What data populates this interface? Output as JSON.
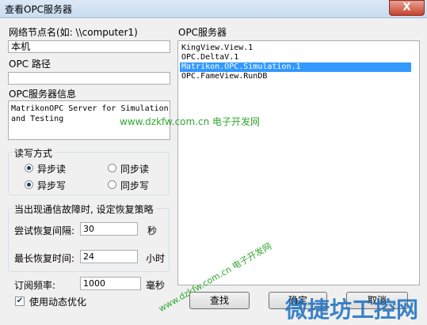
{
  "window": {
    "title": "查看OPC服务器",
    "close_glyph": "X"
  },
  "left": {
    "node_label": "网络节点名(如: \\\\computer1)",
    "node_value": "本机",
    "path_label": "OPC 路径",
    "path_value": "",
    "info_label": "OPC服务器信息",
    "info_lines": [
      "MatrikonOPC Server for Simulation",
      "and Testing"
    ]
  },
  "rw": {
    "title": "读写方式",
    "options": [
      {
        "label": "异步读",
        "checked": true
      },
      {
        "label": "同步读",
        "checked": false
      },
      {
        "label": "异步写",
        "checked": true
      },
      {
        "label": "同步写",
        "checked": false
      }
    ]
  },
  "recovery": {
    "title": "当出现通信故障时, 设定恢复策略",
    "retry_label": "尝试恢复间隔:",
    "retry_value": "30",
    "retry_unit": "秒",
    "max_label": "最长恢复时间:",
    "max_value": "24",
    "max_unit": "小时"
  },
  "subscribe": {
    "label": "订阅频率:",
    "value": "1000",
    "unit": "毫秒"
  },
  "dynamic_opt": {
    "label": "使用动态优化",
    "checked": true,
    "check_glyph": "✔"
  },
  "servers": {
    "label": "OPC服务器",
    "items": [
      {
        "name": "KingView.View.1",
        "selected": false
      },
      {
        "name": "OPC.DeltaV.1",
        "selected": false
      },
      {
        "name": "Matrikon.OPC.Simulation.1",
        "selected": true
      },
      {
        "name": "OPC.FameView.RunDB",
        "selected": false
      }
    ]
  },
  "buttons": {
    "find": "查找",
    "ok": "确定",
    "cancel": "取消"
  },
  "watermark": {
    "url_text": "www.dzkfw.com.cn 电子开发网",
    "big_text": "微捷坊工控网"
  }
}
